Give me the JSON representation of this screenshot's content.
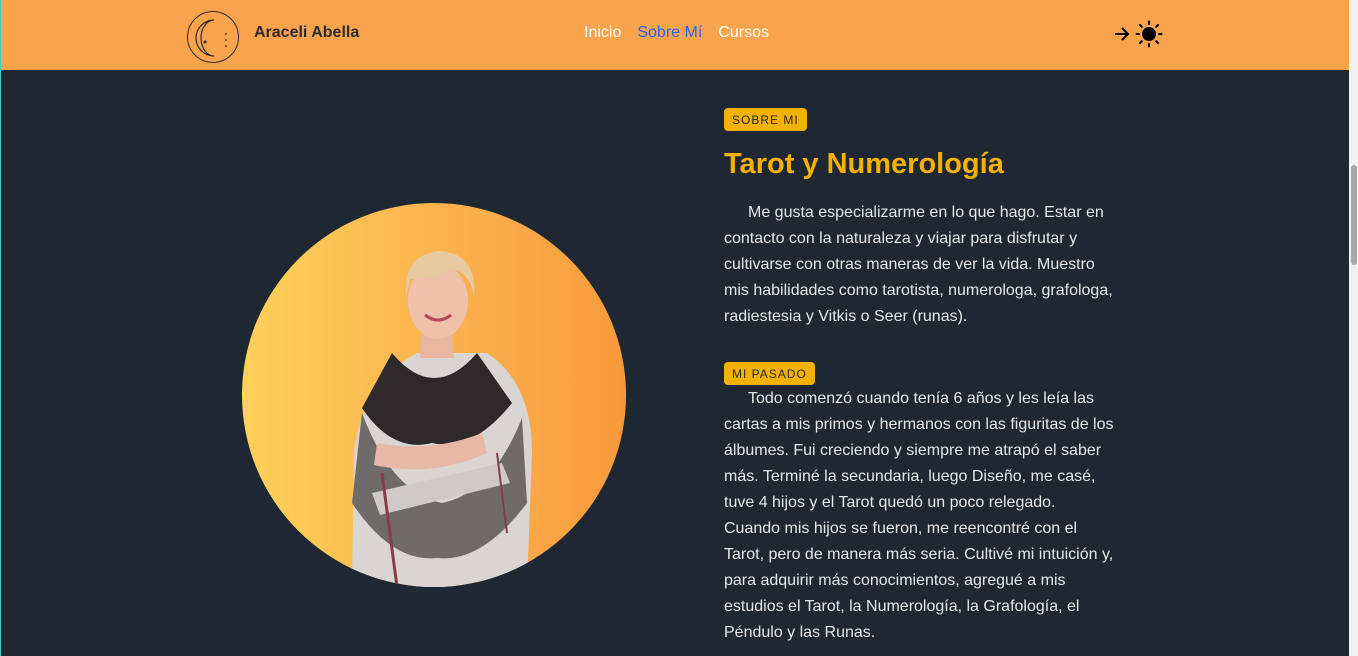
{
  "header": {
    "brand": "Araceli Abella",
    "nav": [
      "Inicio",
      "Sobre Mí",
      "Cursos"
    ],
    "active_nav": "Sobre Mí",
    "icons": [
      "arrow-right-icon",
      "sun-icon"
    ]
  },
  "colors": {
    "header_bg": "#f9a44d",
    "page_bg": "#1f2733",
    "accent": "#f5b100",
    "active_link": "#2563eb"
  },
  "about": {
    "badge": "SOBRE MI",
    "title": "Tarot y Numerología",
    "text": "Me gusta especializarme en lo que hago. Estar en contacto con la naturaleza y viajar para disfrutar y cultivarse con otras maneras de ver la vida. Muestro mis habilidades como tarotista, numerologa, grafologa, radiestesia y Vitkis o Seer (runas)."
  },
  "past": {
    "badge": "MI PASADO",
    "text": "Todo comenzó cuando tenía 6 años y les leía las cartas a mis primos y hermanos con las figuritas de los álbumes. Fui creciendo y siempre me atrapó el saber más. Terminé la secundaria, luego Diseño, me casé, tuve 4 hijos y el Tarot quedó un poco relegado. Cuando mis hijos se fueron, me reencontré con el Tarot, pero de manera más seria. Cultivé mi intuición y, para adquirir más conocimientos, agregué a mis estudios el Tarot, la Numerología, la Grafología, el Péndulo y las Runas."
  }
}
